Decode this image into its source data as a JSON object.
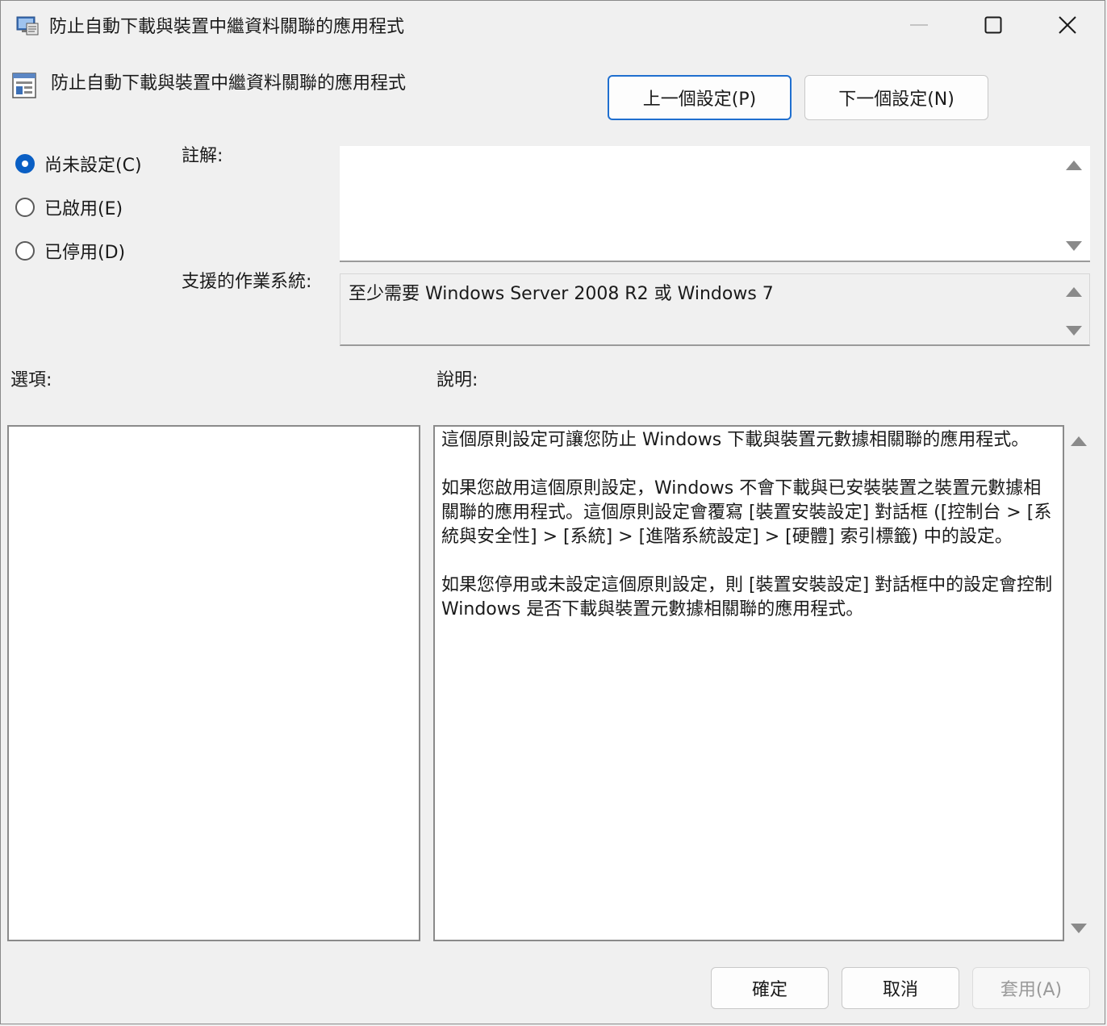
{
  "window": {
    "title": "防止自動下載與裝置中繼資料關聯的應用程式"
  },
  "header": {
    "policy_name": "防止自動下載與裝置中繼資料關聯的應用程式",
    "prev_button": "上一個設定(P)",
    "next_button": "下一個設定(N)"
  },
  "state_options": [
    {
      "label": "尚未設定(C)",
      "selected": true
    },
    {
      "label": "已啟用(E)",
      "selected": false
    },
    {
      "label": "已停用(D)",
      "selected": false
    }
  ],
  "comment": {
    "label": "註解:",
    "value": ""
  },
  "supported_os": {
    "label": "支援的作業系統:",
    "value": "至少需要 Windows Server 2008 R2 或 Windows 7"
  },
  "options": {
    "label": "選項:"
  },
  "help": {
    "label": "說明:",
    "paragraphs": [
      "這個原則設定可讓您防止 Windows 下載與裝置元數據相關聯的應用程式。",
      "如果您啟用這個原則設定，Windows 不會下載與已安裝裝置之裝置元數據相關聯的應用程式。這個原則設定會覆寫 [裝置安裝設定] 對話框 ([控制台 > [系統與安全性] > [系統] > [進階系統設定] > [硬體] 索引標籤) 中的設定。",
      "如果您停用或未設定這個原則設定，則 [裝置安裝設定] 對話框中的設定會控制 Windows 是否下載與裝置元數據相關聯的應用程式。"
    ]
  },
  "footer": {
    "ok": "確定",
    "cancel": "取消",
    "apply": "套用(A)"
  },
  "colors": {
    "accent": "#0a5fc4",
    "focus_border": "#1f6fcf",
    "background": "#f0f0f0"
  },
  "icons": {
    "title": "policy-window-icon",
    "header": "policy-setting-icon"
  }
}
